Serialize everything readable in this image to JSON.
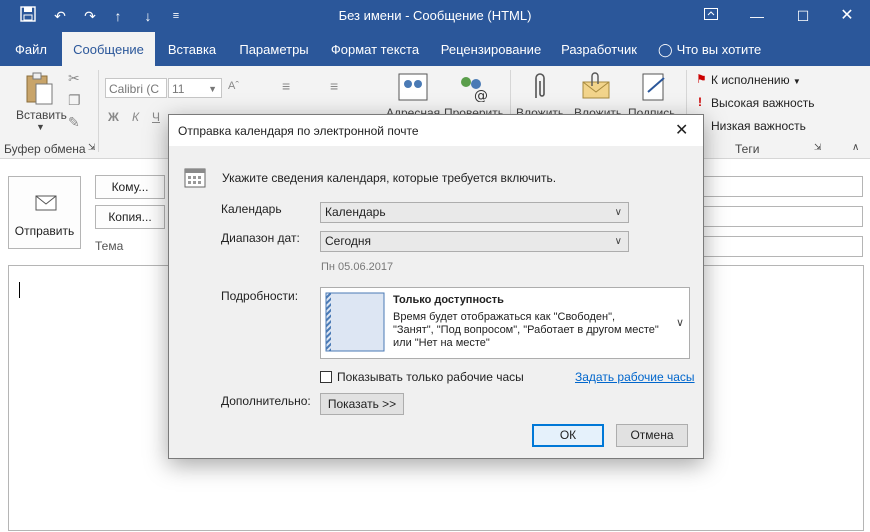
{
  "window": {
    "title": "Без имени  -  Сообщение (HTML)"
  },
  "tabs": [
    {
      "label": "Файл"
    },
    {
      "label": "Сообщение"
    },
    {
      "label": "Вставка"
    },
    {
      "label": "Параметры"
    },
    {
      "label": "Формат текста"
    },
    {
      "label": "Рецензирование"
    },
    {
      "label": "Разработчик"
    },
    {
      "label": "Что вы хотите сделать?"
    }
  ],
  "ribbon": {
    "paste_label": "Вставить",
    "clipboard_group": "Буфер обмена",
    "font_name": "Calibri (С",
    "font_size": "11",
    "bold": "Ж",
    "italic": "К",
    "underline": "Ч",
    "address_book": "Адресная",
    "check_names": "Проверить",
    "attach_file": "Вложить",
    "attach_item": "Вложить",
    "signature": "Подпись",
    "follow_up": "К исполнению",
    "high_importance": "Высокая важность",
    "low_importance": "Низкая важность",
    "tags_group": "Теги"
  },
  "message": {
    "send": "Отправить",
    "to": "Кому...",
    "cc": "Копия...",
    "subject": "Тема"
  },
  "dialog": {
    "title": "Отправка календаря по электронной почте",
    "instruction": "Укажите сведения календаря, которые требуется включить.",
    "calendar_label": "Календарь",
    "calendar_value": "Календарь",
    "range_label": "Диапазон дат:",
    "range_value": "Сегодня",
    "date_text": "Пн 05.06.2017",
    "details_label": "Подробности:",
    "details_title": "Только доступность",
    "details_desc_1": "Время будет отображаться как \"Свободен\",",
    "details_desc_2": "\"Занят\", \"Под вопросом\", \"Работает в другом месте\"",
    "details_desc_3": "или \"Нет на месте\"",
    "working_hours_checkbox": "Показывать только рабочие часы",
    "set_hours_link": "Задать рабочие часы",
    "advanced_label": "Дополнительно:",
    "show_button": "Показать >>",
    "ok": "ОК",
    "cancel": "Отмена"
  }
}
